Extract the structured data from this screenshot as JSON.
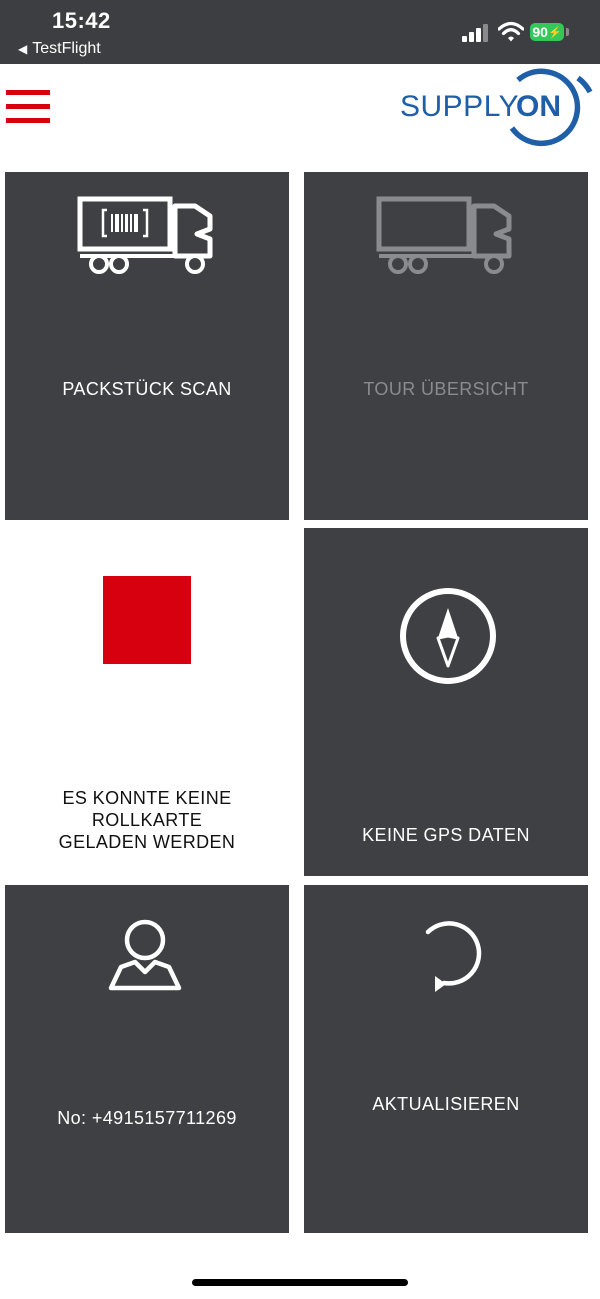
{
  "status_bar": {
    "time": "15:42",
    "back_app": "TestFlight",
    "battery": "90"
  },
  "header": {
    "logo_supply": "SUPPLY",
    "logo_on": "ON",
    "brand_color": "#d7000f",
    "logo_color": "#1f5fa8"
  },
  "tiles": {
    "package_scan": {
      "label": "PACKSTÜCK SCAN",
      "icon": "truck-barcode-icon"
    },
    "tour_overview": {
      "label": "TOUR ÜBERSICHT",
      "icon": "truck-icon",
      "state": "disabled"
    },
    "rollkarte_status": {
      "line1": "ES KONNTE KEINE",
      "line2": "ROLLKARTE",
      "line3": "GELADEN WERDEN",
      "icon": "red-square-icon"
    },
    "gps": {
      "label": "KEINE GPS DATEN",
      "icon": "compass-icon"
    },
    "user": {
      "label": "No: +4915157711269",
      "icon": "user-icon"
    },
    "refresh": {
      "label": "AKTUALISIEREN",
      "icon": "refresh-icon"
    }
  },
  "colors": {
    "tile_dark": "#3f4043",
    "status_bar": "#3d3e41",
    "battery_green": "#34c759"
  }
}
